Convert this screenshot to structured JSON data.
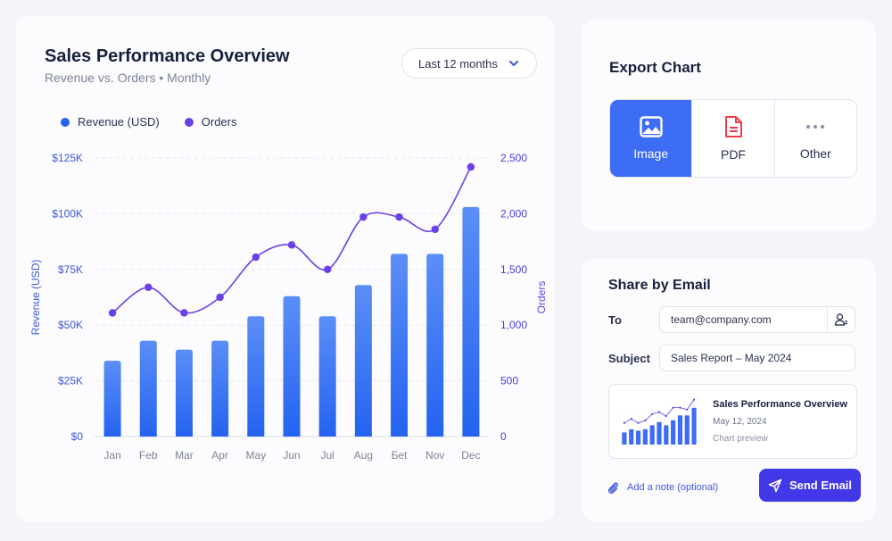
{
  "chart_panel": {
    "title": "Sales Performance Overview",
    "subtitle": "Revenue vs. Orders • Monthly",
    "range_select": "Last 12 months"
  },
  "chart_data": {
    "type": "bar",
    "categories": [
      "Jan",
      "Feb",
      "Mar",
      "Apr",
      "May",
      "Jun",
      "Jul",
      "Aug",
      "Бet",
      "Nov",
      "Dec"
    ],
    "ylabel": "Revenue (USD)",
    "y2label": "Orders",
    "ylim": [
      0,
      125000
    ],
    "y2lim": [
      0,
      2500
    ],
    "yticks": [
      "$0",
      "$25K",
      "$50K",
      "$75K",
      "$100K",
      "$125K"
    ],
    "y2ticks": [
      "0",
      "500",
      "1,000",
      "1,500",
      "2,000",
      "2,500"
    ],
    "grid": true,
    "legend_position": "top-left",
    "series": [
      {
        "name": "Revenue (USD)",
        "kind": "bar",
        "axis": "left",
        "values": [
          34000,
          43000,
          39000,
          43000,
          54000,
          63000,
          54000,
          68000,
          82000,
          82000,
          103000
        ]
      },
      {
        "name": "Orders",
        "kind": "line",
        "axis": "right",
        "values": [
          1110,
          1340,
          1110,
          1250,
          1610,
          1720,
          1500,
          1970,
          1970,
          1860,
          2420
        ]
      }
    ],
    "colors": {
      "bars_top": "#5b8ef6",
      "bars_bottom": "#2463f0",
      "line": "#6a3fe6",
      "revenue_dot": "#2463f0",
      "orders_dot": "#6a3fe6"
    }
  },
  "export": {
    "title": "Export Chart",
    "options": [
      {
        "label": "Image",
        "icon": "image-icon",
        "active": true
      },
      {
        "label": "PDF",
        "icon": "pdf-icon",
        "active": false
      },
      {
        "label": "Other",
        "icon": "more-icon",
        "active": false
      }
    ]
  },
  "share": {
    "title": "Share by Email",
    "to_label": "To",
    "to_value": "team@company.com",
    "subject_label": "Subject",
    "subject_value": "Sales Report – May 2024",
    "preview": {
      "title": "Sales Performance Overview",
      "date": "May 12, 2024",
      "caption": "Chart preview"
    },
    "note_label": "Add a note (optional)",
    "send_label": "Send Email"
  }
}
